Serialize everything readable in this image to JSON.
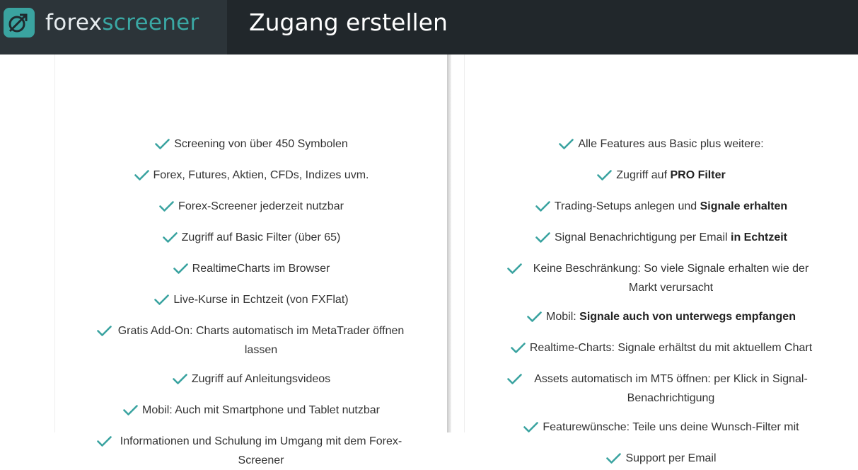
{
  "header": {
    "logo": {
      "part1": "forex",
      "part2": "screener",
      "icon": "logo-arrow-icon"
    },
    "title": "Zugang erstellen"
  },
  "colors": {
    "header_bg": "#21272b",
    "accent": "#3aa8a4",
    "check": "#3aa3a0"
  },
  "basic_features": [
    "Screening von über 450 Symbolen",
    "Forex, Futures, Aktien, CFDs, Indizes uvm.",
    "Forex-Screener jederzeit nutzbar",
    "Zugriff auf Basic Filter (über 65)",
    "RealtimeCharts im Browser",
    "Live-Kurse in Echtzeit (von FXFlat)",
    "Gratis Add-On: Charts automatisch im MetaTrader öffnen lassen",
    "Zugriff auf Anleitungsvideos",
    "Mobil: Auch mit Smartphone und Tablet nutzbar",
    "Informationen und Schulung im Umgang mit dem Forex-Screener"
  ],
  "pro_features": [
    {
      "text": "Alle Features aus Basic plus weitere:",
      "bold": ""
    },
    {
      "text": "Zugriff auf ",
      "bold": "PRO Filter"
    },
    {
      "text": "Trading-Setups anlegen und ",
      "bold": "Signale erhalten"
    },
    {
      "text": "Signal Benachrichtigung per Email ",
      "bold": "in Echtzeit"
    },
    {
      "text": "Keine Beschränkung: So viele Signale erhalten wie der Markt verursacht",
      "bold": ""
    },
    {
      "text": "Mobil: ",
      "bold": "Signale auch von unterwegs empfangen"
    },
    {
      "text": "Realtime-Charts: Signale erhältst du mit aktuellem Chart",
      "bold": ""
    },
    {
      "text": "Assets automatisch im MT5 öffnen: per Klick in Signal-Benachrichtigung",
      "bold": ""
    },
    {
      "text": "Featurewünsche: Teile uns deine Wunsch-Filter mit",
      "bold": ""
    },
    {
      "text": "Support per Email",
      "bold": ""
    }
  ]
}
